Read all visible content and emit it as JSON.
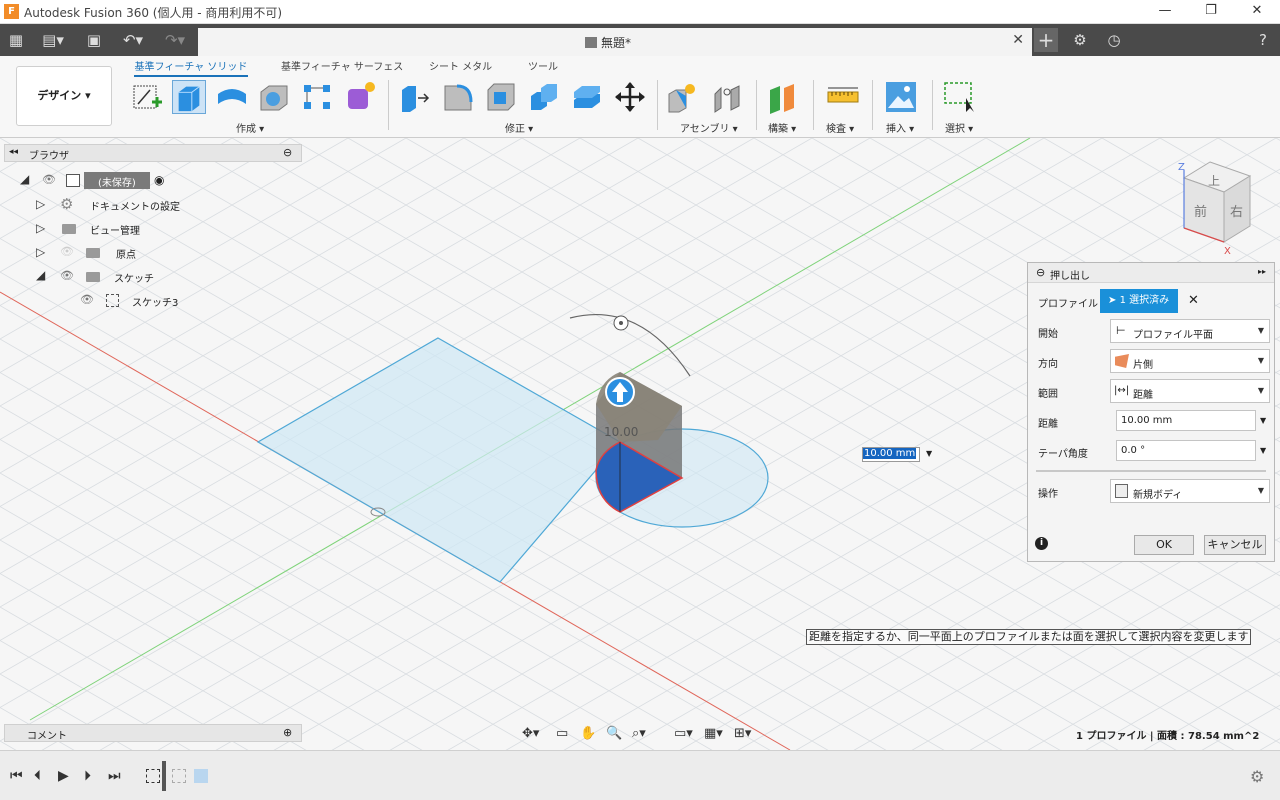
{
  "window": {
    "title": "Autodesk Fusion 360 (個人用 - 商用利用不可)",
    "app_icon": "F"
  },
  "tab": {
    "label": "無題*"
  },
  "ribbon": {
    "workspace": "デザイン ▾",
    "tabs": [
      "基準フィーチャ ソリッド",
      "基準フィーチャ サーフェス",
      "シート メタル",
      "ツール"
    ],
    "groups": [
      "作成 ▾",
      "修正 ▾",
      "アセンブリ ▾",
      "構築 ▾",
      "検査 ▾",
      "挿入 ▾",
      "選択 ▾"
    ]
  },
  "browser": {
    "title": "ブラウザ",
    "root": "(未保存)",
    "items": [
      "ドキュメントの設定",
      "ビュー管理",
      "原点",
      "スケッチ",
      "スケッチ3"
    ]
  },
  "comment": {
    "label": "コメント"
  },
  "viewcube": {
    "top": "上",
    "front": "前",
    "right": "右",
    "z": "Z",
    "x": "X"
  },
  "extrude": {
    "title": "押し出し",
    "profile_label": "プロファイル",
    "profile_value": "1 選択済み",
    "start_label": "開始",
    "start_value": "プロファイル平面",
    "direction_label": "方向",
    "direction_value": "片側",
    "extent_label": "範囲",
    "extent_value": "距離",
    "distance_label": "距離",
    "distance_value": "10.00 mm",
    "taper_label": "テーパ角度",
    "taper_value": "0.0 °",
    "operation_label": "操作",
    "operation_value": "新規ボディ",
    "ok": "OK",
    "cancel": "キャンセル"
  },
  "canvas": {
    "distance_input": "10.00 mm",
    "model_dim": "10.00",
    "hint": "距離を指定するか、同一平面上のプロファイルまたは面を選択して選択内容を変更します"
  },
  "status": {
    "text": "1 プロファイル | 面積 : 78.54 mm^2"
  },
  "colors": {
    "accent": "#1a72b9",
    "grid": "#d2d6da",
    "sketch": "#4fa8d6",
    "selected_face": "#2a62b9"
  }
}
